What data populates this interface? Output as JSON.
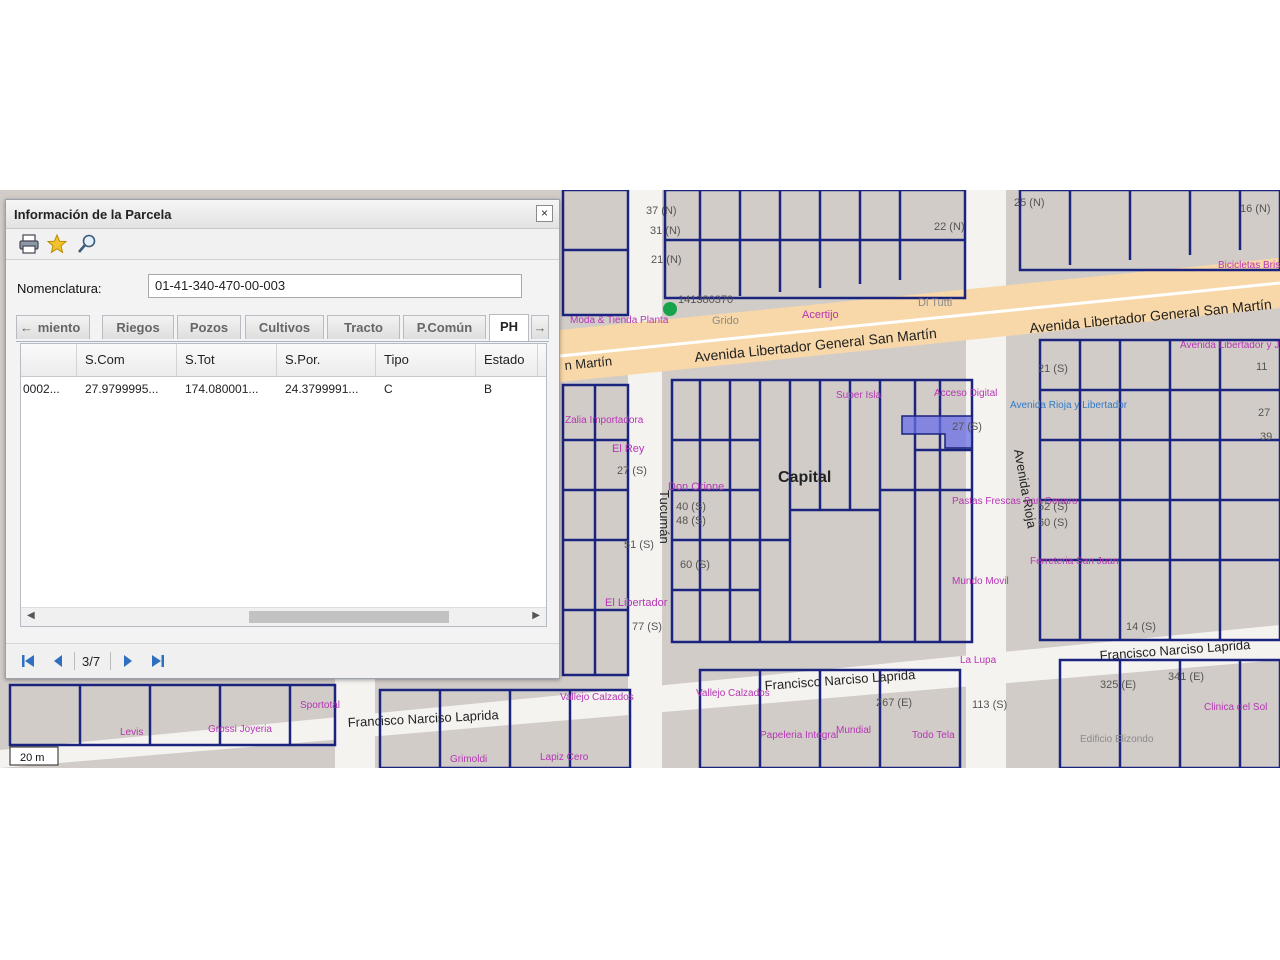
{
  "panel": {
    "title": "Información de la Parcela",
    "close_symbol": "×",
    "toolbar": {
      "icons": [
        "printer-icon",
        "star-icon",
        "search-icon"
      ]
    },
    "nomenclatura_label": "Nomenclatura:",
    "nomenclatura_value": "01-41-340-470-00-003",
    "tabs": [
      "miento",
      "Riegos",
      "Pozos",
      "Cultivos",
      "Tracto",
      "P.Común",
      "PH"
    ],
    "active_tab": "PH",
    "tab_scroll_left": "←",
    "tab_scroll_right": "→",
    "grid": {
      "columns": [
        "S.Com",
        "S.Tot",
        "S.Por.",
        "Tipo",
        "Estado"
      ],
      "rows": [
        [
          "0002...",
          "27.9799995...",
          "174.080001...",
          "24.3799991...",
          "C",
          "B"
        ]
      ]
    },
    "pager": {
      "page": "3/7"
    }
  },
  "map": {
    "streets": [
      "Avenida Libertador General San Martín",
      "Avenida Libertador General San Martín",
      "n Martín",
      "Francisco Narciso Laprida",
      "Francisco Narciso Laprida",
      "Francisco Narciso Laprida",
      "Tucumán",
      "Avenida Rioja"
    ],
    "labels": [
      "Capital",
      "Grido",
      "Acertijo",
      "Di Tutti",
      "El Rey",
      "Don Orione",
      "Super Isla",
      "Acceso Digital",
      "Pastas Frescas San Genaro",
      "Mundo Movil",
      "La Lupa",
      "Ferreteria San Juan",
      "Avenida Rioja y Libertador",
      "Bicicletas Brisson",
      "Avenida Libertador y Jujuy",
      "El Libertador",
      "Vallejo Calzados",
      "Vallejo Calzados",
      "Grossi Joyeria",
      "Sportotal",
      "Levis",
      "Papeleria Integral",
      "Todo Tela",
      "Clinica del Sol",
      "Edificio Elizondo",
      "Lapiz Cero",
      "Grimoldi",
      "Mundial",
      "Zalia Importadora",
      "Moda & Tienda Planta",
      "37 (N)",
      "31 (N)",
      "21 (N)",
      "25 (N)",
      "16 (N)",
      "22 (N)",
      "21 (S)",
      "27 (S)",
      "27 (S)",
      "40 (S)",
      "48 (S)",
      "51 (S)",
      "60 (S)",
      "77 (S)",
      "52 (S)",
      "60 (S)",
      "14 (S)",
      "39",
      "27",
      "11",
      "325 (E)",
      "267 (E)",
      "113 (S)",
      "341 (E)",
      "141380370"
    ],
    "scale": "20 m"
  }
}
